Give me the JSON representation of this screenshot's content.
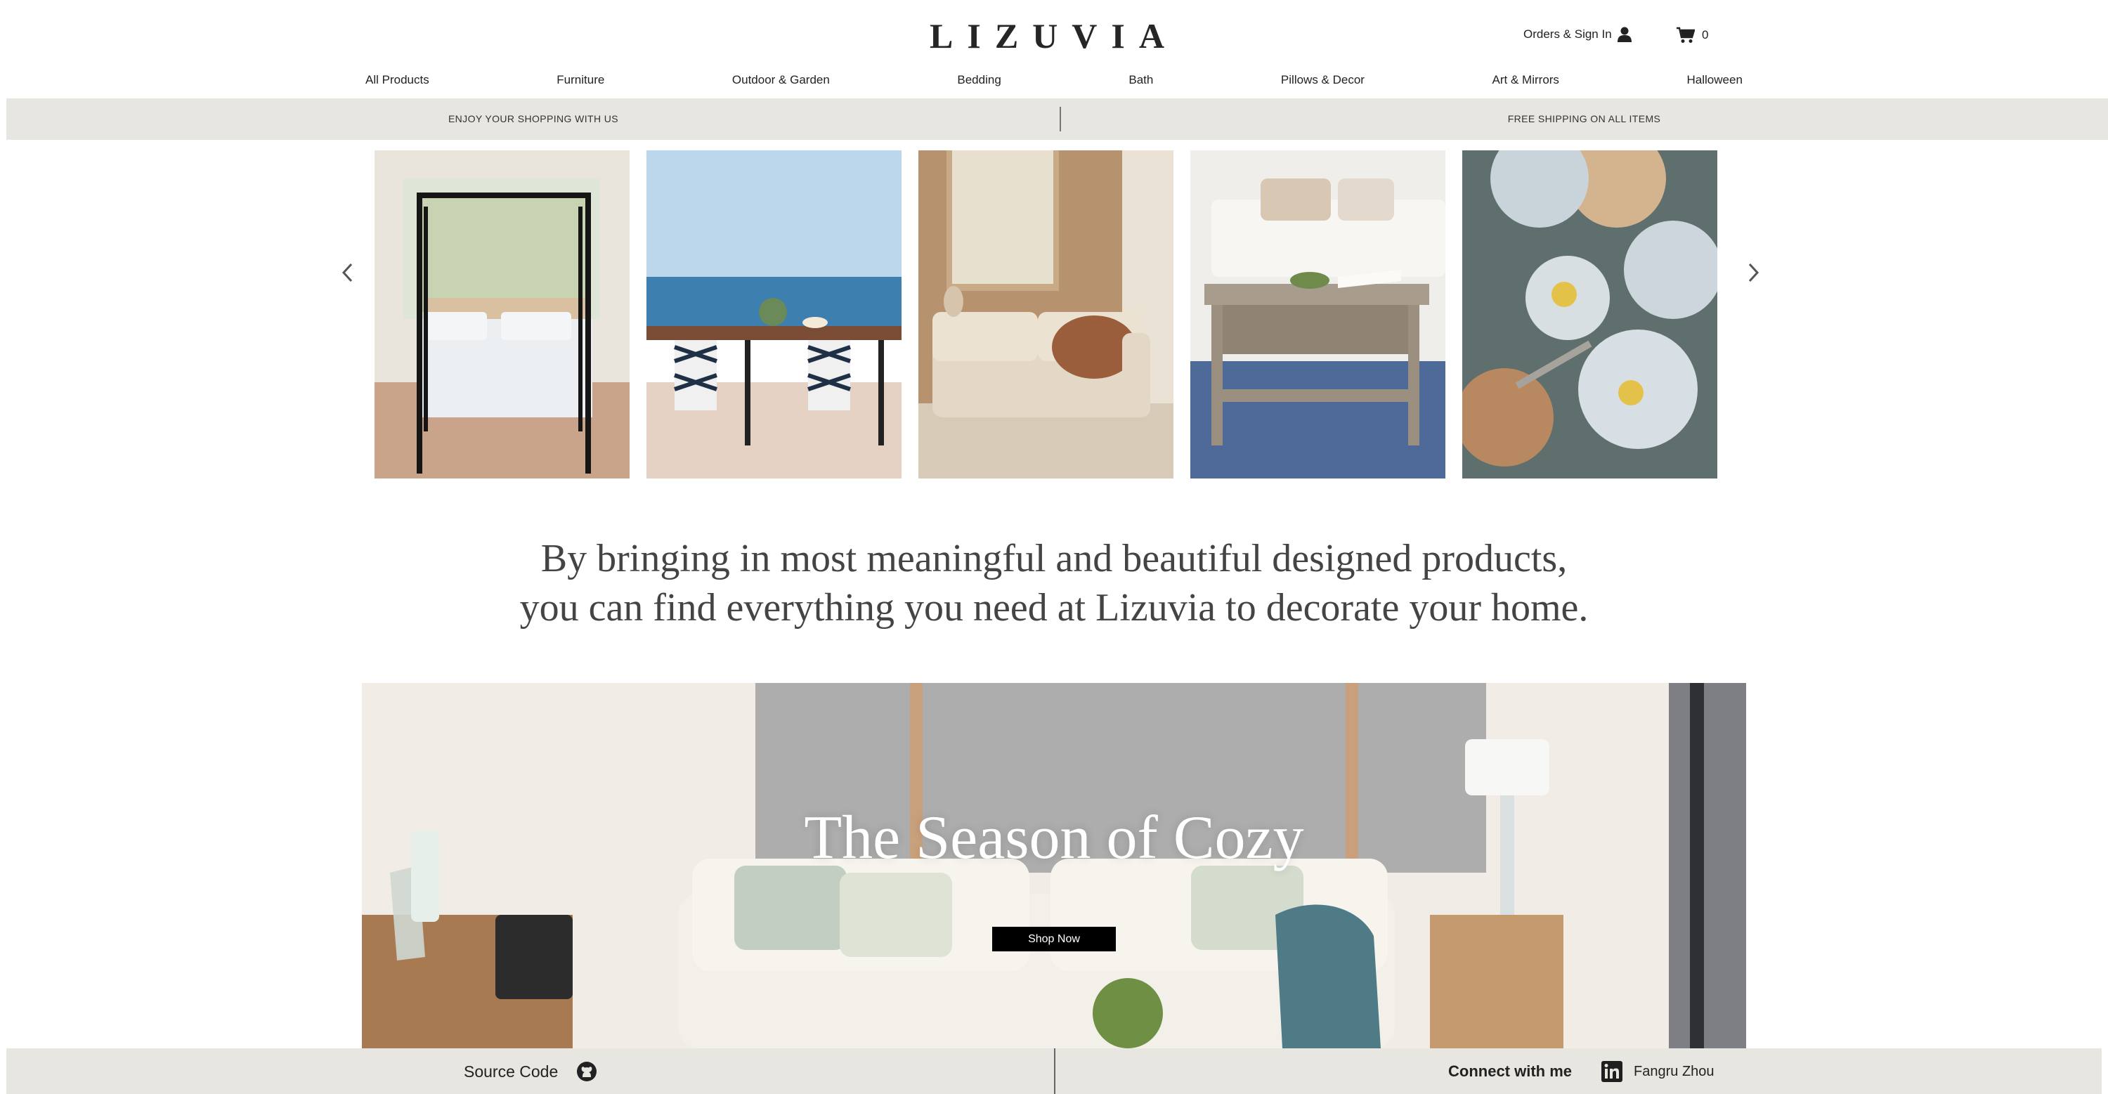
{
  "header": {
    "logo": "LIZUVIA",
    "orders_label": "Orders & Sign In",
    "cart_count": "0"
  },
  "nav": {
    "items": [
      "All Products",
      "Furniture",
      "Outdoor & Garden",
      "Bedding",
      "Bath",
      "Pillows & Decor",
      "Art & Mirrors",
      "Halloween"
    ]
  },
  "promo": {
    "left": "ENJOY YOUR SHOPPING WITH US",
    "right": "FREE SHIPPING ON ALL ITEMS"
  },
  "carousel": {
    "tiles": [
      "canopy-bed",
      "outdoor-dining",
      "sofa-living",
      "coffee-table",
      "dinnerware"
    ]
  },
  "tagline": {
    "line1": "By bringing in most meaningful and beautiful designed products,",
    "line2": "you can find everything you need at Lizuvia to decorate your home."
  },
  "hero": {
    "title": "The Season of Cozy",
    "button": "Shop Now"
  },
  "footer": {
    "source_label": "Source Code",
    "connect_label": "Connect with me",
    "name": "Fangru Zhou"
  },
  "colors": {
    "bar_bg": "#e8e6e0",
    "button_bg": "#000000",
    "text": "#222222"
  }
}
